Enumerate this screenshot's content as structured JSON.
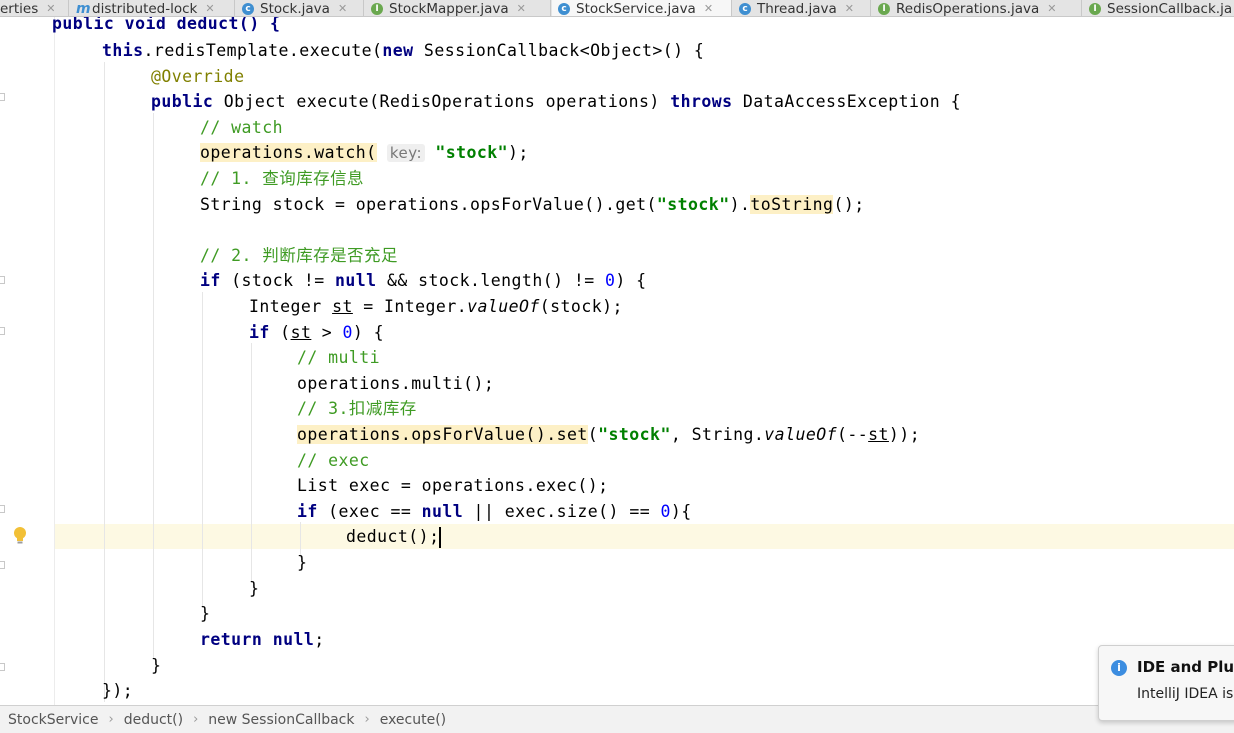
{
  "tabs": [
    {
      "label": "erties",
      "icon": "none"
    },
    {
      "label": "distributed-lock",
      "icon": "m"
    },
    {
      "label": "Stock.java",
      "icon": "c"
    },
    {
      "label": "StockMapper.java",
      "icon": "i"
    },
    {
      "label": "StockService.java",
      "icon": "c",
      "active": true
    },
    {
      "label": "Thread.java",
      "icon": "c"
    },
    {
      "label": "RedisOperations.java",
      "icon": "i"
    },
    {
      "label": "SessionCallback.ja",
      "icon": "i"
    }
  ],
  "code": {
    "l1_partial": "public void deduct() {",
    "l2_this": "this",
    "l2_field": ".redisTemplate.execute(",
    "l2_new": "new",
    "l2_rest": " SessionCallback<Object>() {",
    "l3_ann": "@Override",
    "l4_public": "public",
    "l4_mid": " Object execute(RedisOperations operations) ",
    "l4_throws": "throws",
    "l4_rest": " DataAccessException {",
    "l5_comment": "// watch",
    "l6_call": "operations.watch(",
    "l6_hint": "key:",
    "l6_str": "\"stock\"",
    "l6_end": ");",
    "l7_comment": "// 1. 查询库存信息",
    "l8_start": "String stock = operations.opsForValue().get(",
    "l8_str": "\"stock\"",
    "l8_mid": ").",
    "l8_hl": "toString",
    "l8_end": "();",
    "l10_comment": "// 2. 判断库存是否充足",
    "l11_if": "if",
    "l11_a": " (stock != ",
    "l11_null": "null",
    "l11_b": " && stock.length() != ",
    "l11_zero": "0",
    "l11_c": ") {",
    "l12_a": "Integer ",
    "l12_st": "st",
    "l12_b": " = Integer.",
    "l12_valueof": "valueOf",
    "l12_c": "(stock);",
    "l13_if": "if",
    "l13_a": " (",
    "l13_st": "st",
    "l13_b": " > ",
    "l13_zero": "0",
    "l13_c": ") {",
    "l14_comment": "// multi",
    "l15_code": "operations.multi();",
    "l16_comment": "// 3.扣减库存",
    "l17_hl": "operations.opsForValue().set",
    "l17_a": "(",
    "l17_str": "\"stock\"",
    "l17_b": ", String.",
    "l17_valueof": "valueOf",
    "l17_c": "(--",
    "l17_st": "st",
    "l17_d": "));",
    "l18_comment": "// exec",
    "l19_code": "List exec = operations.exec();",
    "l20_if": "if",
    "l20_a": " (exec == ",
    "l20_null": "null",
    "l20_b": " || exec.size() == ",
    "l20_zero": "0",
    "l20_c": "){",
    "l21_code": "deduct();",
    "l22_brace": "}",
    "l23_brace": "}",
    "l24_brace": "}",
    "l25_return": "return",
    "l25_null": "null",
    "l25_end": ";",
    "l26_brace": "}",
    "l27_end": "});"
  },
  "breadcrumbs": [
    "StockService",
    "deduct()",
    "new SessionCallback",
    "execute()"
  ],
  "notification": {
    "title": "IDE and Plug",
    "text": "IntelliJ IDEA is"
  }
}
